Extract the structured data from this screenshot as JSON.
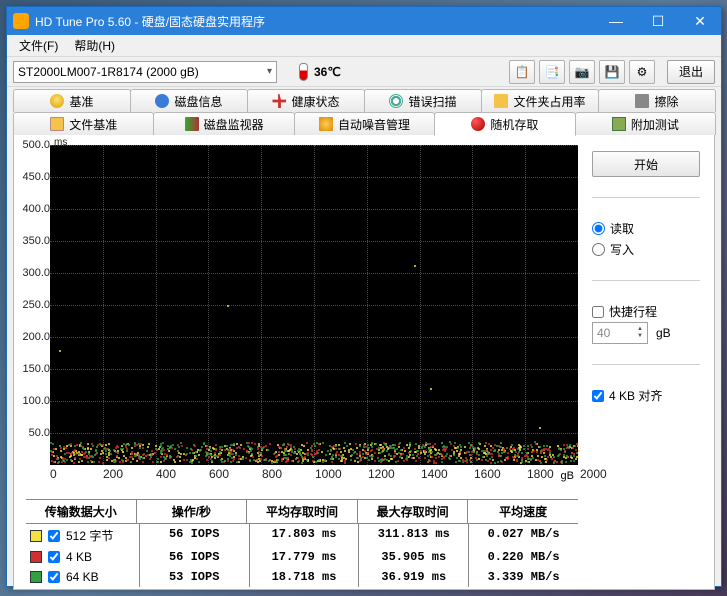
{
  "window": {
    "title": "HD Tune Pro 5.60 - 硬盘/固态硬盘实用程序"
  },
  "menu": {
    "file": "文件(F)",
    "help": "帮助(H)"
  },
  "toolbar": {
    "drive": "ST2000LM007-1R8174 (2000 gB)",
    "temp": "36℃",
    "exit": "退出"
  },
  "tabs": {
    "row1": [
      "基准",
      "磁盘信息",
      "健康状态",
      "错误扫描",
      "文件夹占用率",
      "擦除"
    ],
    "row2": [
      "文件基准",
      "磁盘监视器",
      "自动噪音管理",
      "随机存取",
      "附加测试"
    ]
  },
  "side": {
    "start": "开始",
    "read": "读取",
    "write": "写入",
    "short_stroke": "快捷行程",
    "stroke_val": "40",
    "stroke_unit": "gB",
    "align": "4 KB 对齐"
  },
  "table": {
    "headers": [
      "传输数据大小",
      "操作/秒",
      "平均存取时间",
      "最大存取时间",
      "平均速度"
    ],
    "rows": [
      {
        "color": "#f5e040",
        "label": "512 字节",
        "iops": "56 IOPS",
        "avg": "17.803 ms",
        "max": "311.813 ms",
        "speed": "0.027 MB/s"
      },
      {
        "color": "#d03030",
        "label": "4 KB",
        "iops": "56 IOPS",
        "avg": "17.779 ms",
        "max": "35.905 ms",
        "speed": "0.220 MB/s"
      },
      {
        "color": "#30a040",
        "label": "64 KB",
        "iops": "53 IOPS",
        "avg": "18.718 ms",
        "max": "36.919 ms",
        "speed": "3.339 MB/s"
      }
    ]
  },
  "chart_data": {
    "type": "scatter",
    "title": "",
    "xlabel": "gB",
    "ylabel": "ms",
    "xlim": [
      0,
      2000
    ],
    "ylim": [
      0,
      500
    ],
    "xticks": [
      0,
      200,
      400,
      600,
      800,
      1000,
      1200,
      1400,
      1600,
      1800,
      2000
    ],
    "yticks": [
      50,
      100,
      150,
      200,
      250,
      300,
      350,
      400,
      450,
      500
    ],
    "series": [
      {
        "name": "512 字节",
        "color": "#f5e040",
        "dense_band": [
          5,
          35
        ],
        "y_typical": 18,
        "y_max": 311.8
      },
      {
        "name": "4 KB",
        "color": "#d03030",
        "dense_band": [
          5,
          36
        ],
        "y_typical": 18,
        "y_max": 35.9
      },
      {
        "name": "64 KB",
        "color": "#30a040",
        "dense_band": [
          5,
          37
        ],
        "y_typical": 19,
        "y_max": 36.9
      }
    ],
    "note": "Points are densely clustered in low-ms band across full x-range; a few yellow outliers extend higher."
  }
}
